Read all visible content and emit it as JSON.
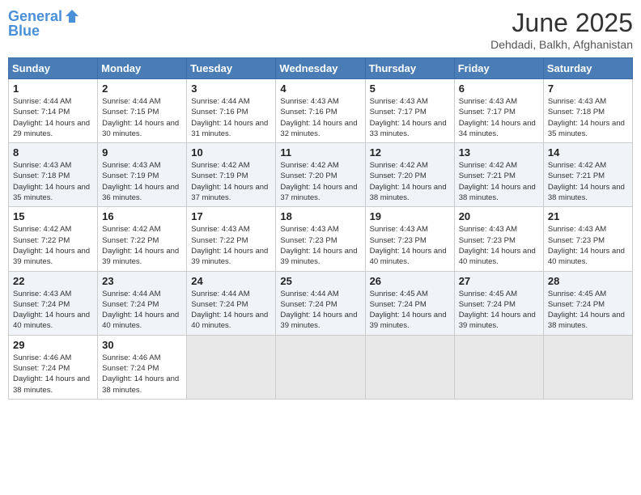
{
  "header": {
    "logo_line1": "General",
    "logo_line2": "Blue",
    "month_title": "June 2025",
    "location": "Dehdadi, Balkh, Afghanistan"
  },
  "days_of_week": [
    "Sunday",
    "Monday",
    "Tuesday",
    "Wednesday",
    "Thursday",
    "Friday",
    "Saturday"
  ],
  "weeks": [
    [
      {
        "day": "1",
        "sunrise": "Sunrise: 4:44 AM",
        "sunset": "Sunset: 7:14 PM",
        "daylight": "Daylight: 14 hours and 29 minutes."
      },
      {
        "day": "2",
        "sunrise": "Sunrise: 4:44 AM",
        "sunset": "Sunset: 7:15 PM",
        "daylight": "Daylight: 14 hours and 30 minutes."
      },
      {
        "day": "3",
        "sunrise": "Sunrise: 4:44 AM",
        "sunset": "Sunset: 7:16 PM",
        "daylight": "Daylight: 14 hours and 31 minutes."
      },
      {
        "day": "4",
        "sunrise": "Sunrise: 4:43 AM",
        "sunset": "Sunset: 7:16 PM",
        "daylight": "Daylight: 14 hours and 32 minutes."
      },
      {
        "day": "5",
        "sunrise": "Sunrise: 4:43 AM",
        "sunset": "Sunset: 7:17 PM",
        "daylight": "Daylight: 14 hours and 33 minutes."
      },
      {
        "day": "6",
        "sunrise": "Sunrise: 4:43 AM",
        "sunset": "Sunset: 7:17 PM",
        "daylight": "Daylight: 14 hours and 34 minutes."
      },
      {
        "day": "7",
        "sunrise": "Sunrise: 4:43 AM",
        "sunset": "Sunset: 7:18 PM",
        "daylight": "Daylight: 14 hours and 35 minutes."
      }
    ],
    [
      {
        "day": "8",
        "sunrise": "Sunrise: 4:43 AM",
        "sunset": "Sunset: 7:18 PM",
        "daylight": "Daylight: 14 hours and 35 minutes."
      },
      {
        "day": "9",
        "sunrise": "Sunrise: 4:43 AM",
        "sunset": "Sunset: 7:19 PM",
        "daylight": "Daylight: 14 hours and 36 minutes."
      },
      {
        "day": "10",
        "sunrise": "Sunrise: 4:42 AM",
        "sunset": "Sunset: 7:19 PM",
        "daylight": "Daylight: 14 hours and 37 minutes."
      },
      {
        "day": "11",
        "sunrise": "Sunrise: 4:42 AM",
        "sunset": "Sunset: 7:20 PM",
        "daylight": "Daylight: 14 hours and 37 minutes."
      },
      {
        "day": "12",
        "sunrise": "Sunrise: 4:42 AM",
        "sunset": "Sunset: 7:20 PM",
        "daylight": "Daylight: 14 hours and 38 minutes."
      },
      {
        "day": "13",
        "sunrise": "Sunrise: 4:42 AM",
        "sunset": "Sunset: 7:21 PM",
        "daylight": "Daylight: 14 hours and 38 minutes."
      },
      {
        "day": "14",
        "sunrise": "Sunrise: 4:42 AM",
        "sunset": "Sunset: 7:21 PM",
        "daylight": "Daylight: 14 hours and 38 minutes."
      }
    ],
    [
      {
        "day": "15",
        "sunrise": "Sunrise: 4:42 AM",
        "sunset": "Sunset: 7:22 PM",
        "daylight": "Daylight: 14 hours and 39 minutes."
      },
      {
        "day": "16",
        "sunrise": "Sunrise: 4:42 AM",
        "sunset": "Sunset: 7:22 PM",
        "daylight": "Daylight: 14 hours and 39 minutes."
      },
      {
        "day": "17",
        "sunrise": "Sunrise: 4:43 AM",
        "sunset": "Sunset: 7:22 PM",
        "daylight": "Daylight: 14 hours and 39 minutes."
      },
      {
        "day": "18",
        "sunrise": "Sunrise: 4:43 AM",
        "sunset": "Sunset: 7:23 PM",
        "daylight": "Daylight: 14 hours and 39 minutes."
      },
      {
        "day": "19",
        "sunrise": "Sunrise: 4:43 AM",
        "sunset": "Sunset: 7:23 PM",
        "daylight": "Daylight: 14 hours and 40 minutes."
      },
      {
        "day": "20",
        "sunrise": "Sunrise: 4:43 AM",
        "sunset": "Sunset: 7:23 PM",
        "daylight": "Daylight: 14 hours and 40 minutes."
      },
      {
        "day": "21",
        "sunrise": "Sunrise: 4:43 AM",
        "sunset": "Sunset: 7:23 PM",
        "daylight": "Daylight: 14 hours and 40 minutes."
      }
    ],
    [
      {
        "day": "22",
        "sunrise": "Sunrise: 4:43 AM",
        "sunset": "Sunset: 7:24 PM",
        "daylight": "Daylight: 14 hours and 40 minutes."
      },
      {
        "day": "23",
        "sunrise": "Sunrise: 4:44 AM",
        "sunset": "Sunset: 7:24 PM",
        "daylight": "Daylight: 14 hours and 40 minutes."
      },
      {
        "day": "24",
        "sunrise": "Sunrise: 4:44 AM",
        "sunset": "Sunset: 7:24 PM",
        "daylight": "Daylight: 14 hours and 40 minutes."
      },
      {
        "day": "25",
        "sunrise": "Sunrise: 4:44 AM",
        "sunset": "Sunset: 7:24 PM",
        "daylight": "Daylight: 14 hours and 39 minutes."
      },
      {
        "day": "26",
        "sunrise": "Sunrise: 4:45 AM",
        "sunset": "Sunset: 7:24 PM",
        "daylight": "Daylight: 14 hours and 39 minutes."
      },
      {
        "day": "27",
        "sunrise": "Sunrise: 4:45 AM",
        "sunset": "Sunset: 7:24 PM",
        "daylight": "Daylight: 14 hours and 39 minutes."
      },
      {
        "day": "28",
        "sunrise": "Sunrise: 4:45 AM",
        "sunset": "Sunset: 7:24 PM",
        "daylight": "Daylight: 14 hours and 38 minutes."
      }
    ],
    [
      {
        "day": "29",
        "sunrise": "Sunrise: 4:46 AM",
        "sunset": "Sunset: 7:24 PM",
        "daylight": "Daylight: 14 hours and 38 minutes."
      },
      {
        "day": "30",
        "sunrise": "Sunrise: 4:46 AM",
        "sunset": "Sunset: 7:24 PM",
        "daylight": "Daylight: 14 hours and 38 minutes."
      },
      {
        "day": "",
        "sunrise": "",
        "sunset": "",
        "daylight": ""
      },
      {
        "day": "",
        "sunrise": "",
        "sunset": "",
        "daylight": ""
      },
      {
        "day": "",
        "sunrise": "",
        "sunset": "",
        "daylight": ""
      },
      {
        "day": "",
        "sunrise": "",
        "sunset": "",
        "daylight": ""
      },
      {
        "day": "",
        "sunrise": "",
        "sunset": "",
        "daylight": ""
      }
    ]
  ]
}
